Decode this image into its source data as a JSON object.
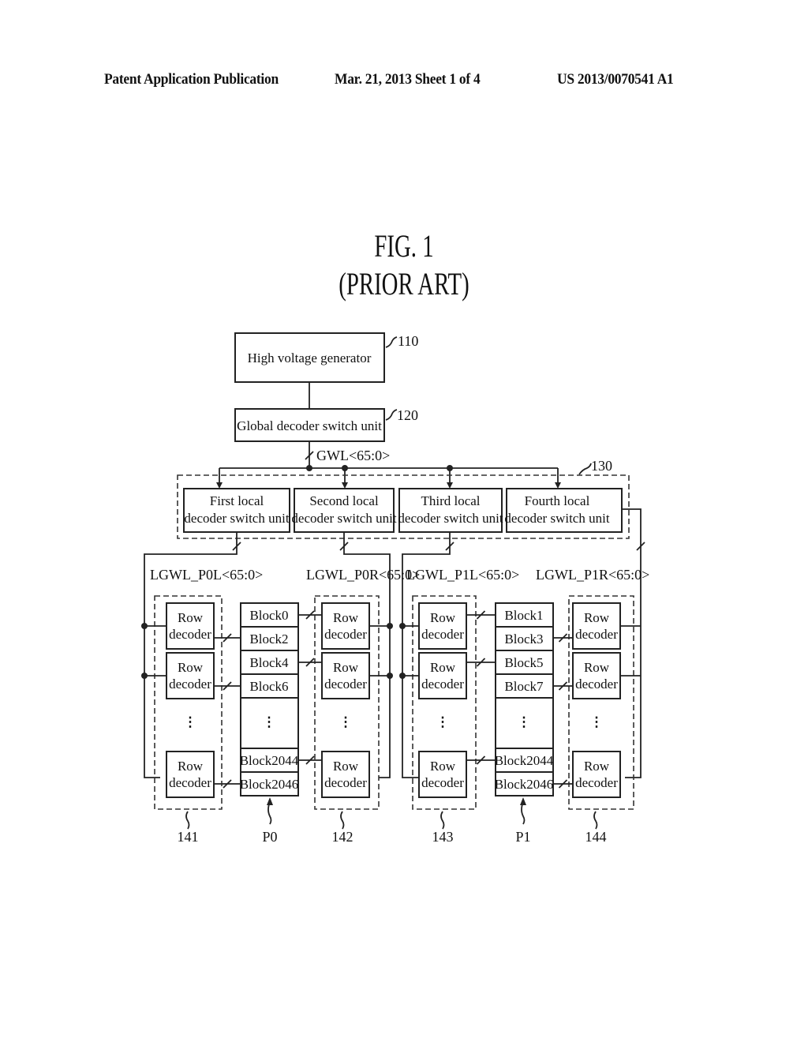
{
  "header": {
    "publication": "Patent Application Publication",
    "date_sheet": "Mar. 21, 2013  Sheet 1 of 4",
    "pub_number": "US 2013/0070541 A1"
  },
  "figure": {
    "title": "FIG. 1",
    "subtitle": "(PRIOR ART)"
  },
  "diagram": {
    "high_voltage_generator": {
      "label": "High voltage generator",
      "ref": "110"
    },
    "global_decoder": {
      "label": "Global decoder switch unit",
      "ref": "120",
      "bus": "GWL<65:0>"
    },
    "local_group_ref": "130",
    "local_units": [
      {
        "line1": "First local",
        "line2": "decoder switch unit",
        "bus": "LGWL_P0L<65:0>"
      },
      {
        "line1": "Second local",
        "line2": "decoder switch unit",
        "bus": "LGWL_P0R<65:0>"
      },
      {
        "line1": "Third local",
        "line2": "decoder switch unit",
        "bus": "LGWL_P1L<65:0>"
      },
      {
        "line1": "Fourth local",
        "line2": "decoder switch unit",
        "bus": "LGWL_P1R<65:0>"
      }
    ],
    "row_decoder": {
      "line1": "Row",
      "line2": "decoder"
    },
    "decoder_groups": [
      {
        "ref": "141"
      },
      {
        "ref": "142"
      },
      {
        "ref": "143"
      },
      {
        "ref": "144"
      }
    ],
    "planes": [
      {
        "ref": "P0",
        "blocks": [
          "Block0",
          "Block2",
          "Block4",
          "Block6",
          "Block2044",
          "Block2046"
        ]
      },
      {
        "ref": "P1",
        "blocks": [
          "Block1",
          "Block3",
          "Block5",
          "Block7",
          "Block2044",
          "Block2046"
        ]
      }
    ],
    "ellipsis": "⋮"
  }
}
